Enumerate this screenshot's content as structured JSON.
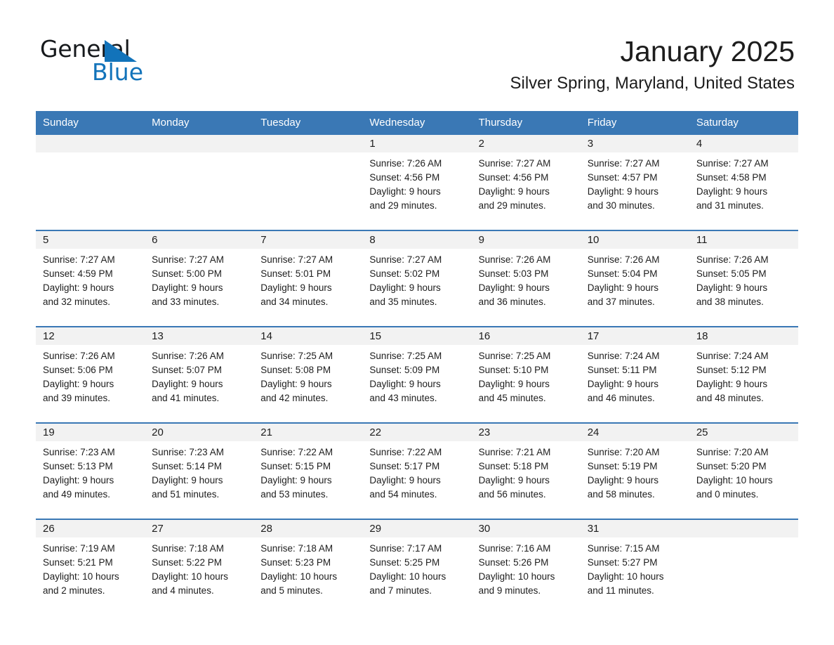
{
  "brand": {
    "name_part1": "General",
    "name_part2": "Blue",
    "triangle_color": "#1273ba",
    "text_color": "#16191c"
  },
  "header": {
    "month_title": "January 2025",
    "location": "Silver Spring, Maryland, United States"
  },
  "theme": {
    "header_bg": "#3a78b5",
    "daynum_bg": "#f2f2f2",
    "separator": "#3a78b5",
    "text": "#1d1d1d"
  },
  "weekday_headers": [
    "Sunday",
    "Monday",
    "Tuesday",
    "Wednesday",
    "Thursday",
    "Friday",
    "Saturday"
  ],
  "weeks": [
    [
      {
        "day": "",
        "sunrise": "",
        "sunset": "",
        "daylight_line1": "",
        "daylight_line2": ""
      },
      {
        "day": "",
        "sunrise": "",
        "sunset": "",
        "daylight_line1": "",
        "daylight_line2": ""
      },
      {
        "day": "",
        "sunrise": "",
        "sunset": "",
        "daylight_line1": "",
        "daylight_line2": ""
      },
      {
        "day": "1",
        "sunrise": "Sunrise: 7:26 AM",
        "sunset": "Sunset: 4:56 PM",
        "daylight_line1": "Daylight: 9 hours",
        "daylight_line2": "and 29 minutes."
      },
      {
        "day": "2",
        "sunrise": "Sunrise: 7:27 AM",
        "sunset": "Sunset: 4:56 PM",
        "daylight_line1": "Daylight: 9 hours",
        "daylight_line2": "and 29 minutes."
      },
      {
        "day": "3",
        "sunrise": "Sunrise: 7:27 AM",
        "sunset": "Sunset: 4:57 PM",
        "daylight_line1": "Daylight: 9 hours",
        "daylight_line2": "and 30 minutes."
      },
      {
        "day": "4",
        "sunrise": "Sunrise: 7:27 AM",
        "sunset": "Sunset: 4:58 PM",
        "daylight_line1": "Daylight: 9 hours",
        "daylight_line2": "and 31 minutes."
      }
    ],
    [
      {
        "day": "5",
        "sunrise": "Sunrise: 7:27 AM",
        "sunset": "Sunset: 4:59 PM",
        "daylight_line1": "Daylight: 9 hours",
        "daylight_line2": "and 32 minutes."
      },
      {
        "day": "6",
        "sunrise": "Sunrise: 7:27 AM",
        "sunset": "Sunset: 5:00 PM",
        "daylight_line1": "Daylight: 9 hours",
        "daylight_line2": "and 33 minutes."
      },
      {
        "day": "7",
        "sunrise": "Sunrise: 7:27 AM",
        "sunset": "Sunset: 5:01 PM",
        "daylight_line1": "Daylight: 9 hours",
        "daylight_line2": "and 34 minutes."
      },
      {
        "day": "8",
        "sunrise": "Sunrise: 7:27 AM",
        "sunset": "Sunset: 5:02 PM",
        "daylight_line1": "Daylight: 9 hours",
        "daylight_line2": "and 35 minutes."
      },
      {
        "day": "9",
        "sunrise": "Sunrise: 7:26 AM",
        "sunset": "Sunset: 5:03 PM",
        "daylight_line1": "Daylight: 9 hours",
        "daylight_line2": "and 36 minutes."
      },
      {
        "day": "10",
        "sunrise": "Sunrise: 7:26 AM",
        "sunset": "Sunset: 5:04 PM",
        "daylight_line1": "Daylight: 9 hours",
        "daylight_line2": "and 37 minutes."
      },
      {
        "day": "11",
        "sunrise": "Sunrise: 7:26 AM",
        "sunset": "Sunset: 5:05 PM",
        "daylight_line1": "Daylight: 9 hours",
        "daylight_line2": "and 38 minutes."
      }
    ],
    [
      {
        "day": "12",
        "sunrise": "Sunrise: 7:26 AM",
        "sunset": "Sunset: 5:06 PM",
        "daylight_line1": "Daylight: 9 hours",
        "daylight_line2": "and 39 minutes."
      },
      {
        "day": "13",
        "sunrise": "Sunrise: 7:26 AM",
        "sunset": "Sunset: 5:07 PM",
        "daylight_line1": "Daylight: 9 hours",
        "daylight_line2": "and 41 minutes."
      },
      {
        "day": "14",
        "sunrise": "Sunrise: 7:25 AM",
        "sunset": "Sunset: 5:08 PM",
        "daylight_line1": "Daylight: 9 hours",
        "daylight_line2": "and 42 minutes."
      },
      {
        "day": "15",
        "sunrise": "Sunrise: 7:25 AM",
        "sunset": "Sunset: 5:09 PM",
        "daylight_line1": "Daylight: 9 hours",
        "daylight_line2": "and 43 minutes."
      },
      {
        "day": "16",
        "sunrise": "Sunrise: 7:25 AM",
        "sunset": "Sunset: 5:10 PM",
        "daylight_line1": "Daylight: 9 hours",
        "daylight_line2": "and 45 minutes."
      },
      {
        "day": "17",
        "sunrise": "Sunrise: 7:24 AM",
        "sunset": "Sunset: 5:11 PM",
        "daylight_line1": "Daylight: 9 hours",
        "daylight_line2": "and 46 minutes."
      },
      {
        "day": "18",
        "sunrise": "Sunrise: 7:24 AM",
        "sunset": "Sunset: 5:12 PM",
        "daylight_line1": "Daylight: 9 hours",
        "daylight_line2": "and 48 minutes."
      }
    ],
    [
      {
        "day": "19",
        "sunrise": "Sunrise: 7:23 AM",
        "sunset": "Sunset: 5:13 PM",
        "daylight_line1": "Daylight: 9 hours",
        "daylight_line2": "and 49 minutes."
      },
      {
        "day": "20",
        "sunrise": "Sunrise: 7:23 AM",
        "sunset": "Sunset: 5:14 PM",
        "daylight_line1": "Daylight: 9 hours",
        "daylight_line2": "and 51 minutes."
      },
      {
        "day": "21",
        "sunrise": "Sunrise: 7:22 AM",
        "sunset": "Sunset: 5:15 PM",
        "daylight_line1": "Daylight: 9 hours",
        "daylight_line2": "and 53 minutes."
      },
      {
        "day": "22",
        "sunrise": "Sunrise: 7:22 AM",
        "sunset": "Sunset: 5:17 PM",
        "daylight_line1": "Daylight: 9 hours",
        "daylight_line2": "and 54 minutes."
      },
      {
        "day": "23",
        "sunrise": "Sunrise: 7:21 AM",
        "sunset": "Sunset: 5:18 PM",
        "daylight_line1": "Daylight: 9 hours",
        "daylight_line2": "and 56 minutes."
      },
      {
        "day": "24",
        "sunrise": "Sunrise: 7:20 AM",
        "sunset": "Sunset: 5:19 PM",
        "daylight_line1": "Daylight: 9 hours",
        "daylight_line2": "and 58 minutes."
      },
      {
        "day": "25",
        "sunrise": "Sunrise: 7:20 AM",
        "sunset": "Sunset: 5:20 PM",
        "daylight_line1": "Daylight: 10 hours",
        "daylight_line2": "and 0 minutes."
      }
    ],
    [
      {
        "day": "26",
        "sunrise": "Sunrise: 7:19 AM",
        "sunset": "Sunset: 5:21 PM",
        "daylight_line1": "Daylight: 10 hours",
        "daylight_line2": "and 2 minutes."
      },
      {
        "day": "27",
        "sunrise": "Sunrise: 7:18 AM",
        "sunset": "Sunset: 5:22 PM",
        "daylight_line1": "Daylight: 10 hours",
        "daylight_line2": "and 4 minutes."
      },
      {
        "day": "28",
        "sunrise": "Sunrise: 7:18 AM",
        "sunset": "Sunset: 5:23 PM",
        "daylight_line1": "Daylight: 10 hours",
        "daylight_line2": "and 5 minutes."
      },
      {
        "day": "29",
        "sunrise": "Sunrise: 7:17 AM",
        "sunset": "Sunset: 5:25 PM",
        "daylight_line1": "Daylight: 10 hours",
        "daylight_line2": "and 7 minutes."
      },
      {
        "day": "30",
        "sunrise": "Sunrise: 7:16 AM",
        "sunset": "Sunset: 5:26 PM",
        "daylight_line1": "Daylight: 10 hours",
        "daylight_line2": "and 9 minutes."
      },
      {
        "day": "31",
        "sunrise": "Sunrise: 7:15 AM",
        "sunset": "Sunset: 5:27 PM",
        "daylight_line1": "Daylight: 10 hours",
        "daylight_line2": "and 11 minutes."
      },
      {
        "day": "",
        "sunrise": "",
        "sunset": "",
        "daylight_line1": "",
        "daylight_line2": ""
      }
    ]
  ]
}
